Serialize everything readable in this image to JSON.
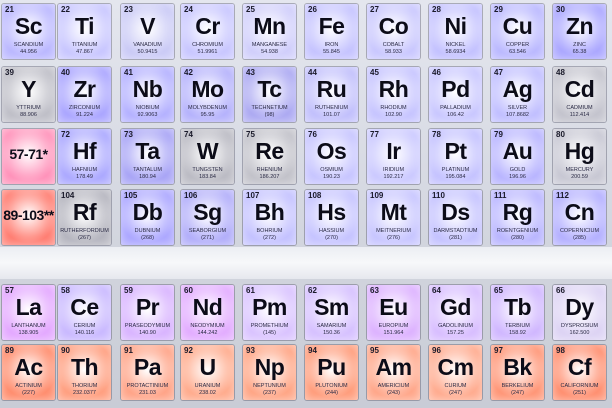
{
  "rows": [
    {
      "cells": [
        {
          "number": "21",
          "symbol": "Sc",
          "name": "SCANDIUM",
          "mass": "44.956",
          "color": "#b9b6ff"
        },
        {
          "number": "22",
          "symbol": "Ti",
          "name": "TITANIUM",
          "mass": "47.867",
          "color": "#c7c5ff"
        },
        {
          "number": "23",
          "symbol": "V",
          "name": "VANADIUM",
          "mass": "50.9415",
          "color": "#c9c9f6"
        },
        {
          "number": "24",
          "symbol": "Cr",
          "name": "CHROMIUM",
          "mass": "51.9961",
          "color": "#c7c5ff"
        },
        {
          "number": "25",
          "symbol": "Mn",
          "name": "MANGANESE",
          "mass": "54.938",
          "color": "#cfcdfb"
        },
        {
          "number": "26",
          "symbol": "Fe",
          "name": "IRON",
          "mass": "55.845",
          "color": "#c4c2ff"
        },
        {
          "number": "27",
          "symbol": "Co",
          "name": "COBALT",
          "mass": "58.933",
          "color": "#c8c6fe"
        },
        {
          "number": "28",
          "symbol": "Ni",
          "name": "NICKEL",
          "mass": "58.6934",
          "color": "#c2c0ff"
        },
        {
          "number": "29",
          "symbol": "Cu",
          "name": "COPPER",
          "mass": "63.546",
          "color": "#b9b7ff"
        },
        {
          "number": "30",
          "symbol": "Zn",
          "name": "ZINC",
          "mass": "65.38",
          "color": "#a9a5ff"
        }
      ]
    },
    {
      "cells": [
        {
          "number": "39",
          "symbol": "Y",
          "name": "YTTRIUM",
          "mass": "88.906",
          "color": "#bdbdc6"
        },
        {
          "number": "40",
          "symbol": "Zr",
          "name": "ZIRCONIUM",
          "mass": "91.224",
          "color": "#a8a3ff"
        },
        {
          "number": "41",
          "symbol": "Nb",
          "name": "NIOBIUM",
          "mass": "92.9063",
          "color": "#b2afff"
        },
        {
          "number": "42",
          "symbol": "Mo",
          "name": "MOLYBDENUM",
          "mass": "95.95",
          "color": "#b3b0fc"
        },
        {
          "number": "43",
          "symbol": "Tc",
          "name": "TECHNETIUM",
          "mass": "(98)",
          "color": "#aaa7f2"
        },
        {
          "number": "44",
          "symbol": "Ru",
          "name": "RUTHENIUM",
          "mass": "101.07",
          "color": "#c0befc"
        },
        {
          "number": "45",
          "symbol": "Rh",
          "name": "RHODIUM",
          "mass": "102.90",
          "color": "#c5c3ff"
        },
        {
          "number": "46",
          "symbol": "Pd",
          "name": "PALLADIUM",
          "mass": "106.42",
          "color": "#c8c6ff"
        },
        {
          "number": "47",
          "symbol": "Ag",
          "name": "SILVER",
          "mass": "107.8682",
          "color": "#bfbdff"
        },
        {
          "number": "48",
          "symbol": "Cd",
          "name": "CADMIUM",
          "mass": "112.414",
          "color": "#c2c2cc"
        }
      ]
    },
    {
      "cells": [
        {
          "number": "",
          "symbol": "57-71*",
          "name": "",
          "mass": "",
          "color": "#ff8fb8"
        },
        {
          "number": "72",
          "symbol": "Hf",
          "name": "HAFNIUM",
          "mass": "178.49",
          "color": "#a9a6ff"
        },
        {
          "number": "73",
          "symbol": "Ta",
          "name": "TANTALUM",
          "mass": "180.94",
          "color": "#a6a2f6"
        },
        {
          "number": "74",
          "symbol": "W",
          "name": "TUNGSTEN",
          "mass": "183.84",
          "color": "#b9b9c2"
        },
        {
          "number": "75",
          "symbol": "Re",
          "name": "RHENIUM",
          "mass": "186.207",
          "color": "#c0c0c8"
        },
        {
          "number": "76",
          "symbol": "Os",
          "name": "OSMIUM",
          "mass": "190.23",
          "color": "#c6c4ff"
        },
        {
          "number": "77",
          "symbol": "Ir",
          "name": "IRIDIUM",
          "mass": "192.217",
          "color": "#cac8ff"
        },
        {
          "number": "78",
          "symbol": "Pt",
          "name": "PLATINUM",
          "mass": "195.084",
          "color": "#c3c1ff"
        },
        {
          "number": "79",
          "symbol": "Au",
          "name": "GOLD",
          "mass": "196.96",
          "color": "#b7b3ff"
        },
        {
          "number": "80",
          "symbol": "Hg",
          "name": "MERCURY",
          "mass": "200.59",
          "color": "#c6c6d2"
        }
      ]
    },
    {
      "cells": [
        {
          "number": "",
          "symbol": "89-103**",
          "name": "",
          "mass": "",
          "color": "#ff7a6e"
        },
        {
          "number": "104",
          "symbol": "Rf",
          "name": "RUTHERFORDIUM",
          "mass": "(267)",
          "color": "#b3b3bd"
        },
        {
          "number": "105",
          "symbol": "Db",
          "name": "DUBNIUM",
          "mass": "(268)",
          "color": "#aaa5ff"
        },
        {
          "number": "106",
          "symbol": "Sg",
          "name": "SEABORGIUM",
          "mass": "(271)",
          "color": "#b0acfa"
        },
        {
          "number": "107",
          "symbol": "Bh",
          "name": "BOHRIUM",
          "mass": "(272)",
          "color": "#c2c0ff"
        },
        {
          "number": "108",
          "symbol": "Hs",
          "name": "HASSIUM",
          "mass": "(270)",
          "color": "#c4c2ff"
        },
        {
          "number": "109",
          "symbol": "Mt",
          "name": "MEITNERIUM",
          "mass": "(276)",
          "color": "#c6c4ff"
        },
        {
          "number": "110",
          "symbol": "Ds",
          "name": "DARMSTADTIUM",
          "mass": "(281)",
          "color": "#c3c1ff"
        },
        {
          "number": "111",
          "symbol": "Rg",
          "name": "ROENTGENIUM",
          "mass": "(280)",
          "color": "#b8b4ff"
        },
        {
          "number": "112",
          "symbol": "Cn",
          "name": "COPERNICIUM",
          "mass": "(285)",
          "color": "#b2aeff"
        }
      ]
    },
    {
      "cells": [
        {
          "number": "57",
          "symbol": "La",
          "name": "LANTHANUM",
          "mass": "138.905",
          "color": "#e3a6ff"
        },
        {
          "number": "58",
          "symbol": "Ce",
          "name": "CERIUM",
          "mass": "140.116",
          "color": "#c8b7ff"
        },
        {
          "number": "59",
          "symbol": "Pr",
          "name": "PRASEODYMIUM",
          "mass": "140.90",
          "color": "#d8b2ff"
        },
        {
          "number": "60",
          "symbol": "Nd",
          "name": "NEODYMIUM",
          "mass": "144.242",
          "color": "#e2aaff"
        },
        {
          "number": "61",
          "symbol": "Pm",
          "name": "PROMETHIUM",
          "mass": "(145)",
          "color": "#d9c2ff"
        },
        {
          "number": "62",
          "symbol": "Sm",
          "name": "SAMARIUM",
          "mass": "150.36",
          "color": "#d5bfff"
        },
        {
          "number": "63",
          "symbol": "Eu",
          "name": "EUROPIUM",
          "mass": "151.964",
          "color": "#dcb0ff"
        },
        {
          "number": "64",
          "symbol": "Gd",
          "name": "GADOLINIUM",
          "mass": "157.25",
          "color": "#d7bcff"
        },
        {
          "number": "65",
          "symbol": "Tb",
          "name": "TERBIUM",
          "mass": "158.92",
          "color": "#cfb5ff"
        },
        {
          "number": "66",
          "symbol": "Dy",
          "name": "DYSPROSIUM",
          "mass": "162.500",
          "color": "#dcd2f4"
        }
      ]
    },
    {
      "cells": [
        {
          "number": "89",
          "symbol": "Ac",
          "name": "ACTINIUM",
          "mass": "(227)",
          "color": "#ff8a6a"
        },
        {
          "number": "90",
          "symbol": "Th",
          "name": "THORIUM",
          "mass": "232.0377",
          "color": "#ff9c7c"
        },
        {
          "number": "91",
          "symbol": "Pa",
          "name": "PROTACTINIUM",
          "mass": "231.03",
          "color": "#ffa184"
        },
        {
          "number": "92",
          "symbol": "U",
          "name": "URANIUM",
          "mass": "238.02",
          "color": "#ffa98a"
        },
        {
          "number": "93",
          "symbol": "Np",
          "name": "NEPTUNIUM",
          "mass": "(237)",
          "color": "#ffa382"
        },
        {
          "number": "94",
          "symbol": "Pu",
          "name": "PLUTONIUM",
          "mass": "(244)",
          "color": "#ff9a78"
        },
        {
          "number": "95",
          "symbol": "Am",
          "name": "AMERICIUM",
          "mass": "(243)",
          "color": "#ffa486"
        },
        {
          "number": "96",
          "symbol": "Cm",
          "name": "CURIUM",
          "mass": "(247)",
          "color": "#ffa98c"
        },
        {
          "number": "97",
          "symbol": "Bk",
          "name": "BERKELIUM",
          "mass": "(247)",
          "color": "#ff9373"
        },
        {
          "number": "98",
          "symbol": "Cf",
          "name": "CALIFORNIUM",
          "mass": "(251)",
          "color": "#ff8c6c"
        }
      ]
    }
  ]
}
